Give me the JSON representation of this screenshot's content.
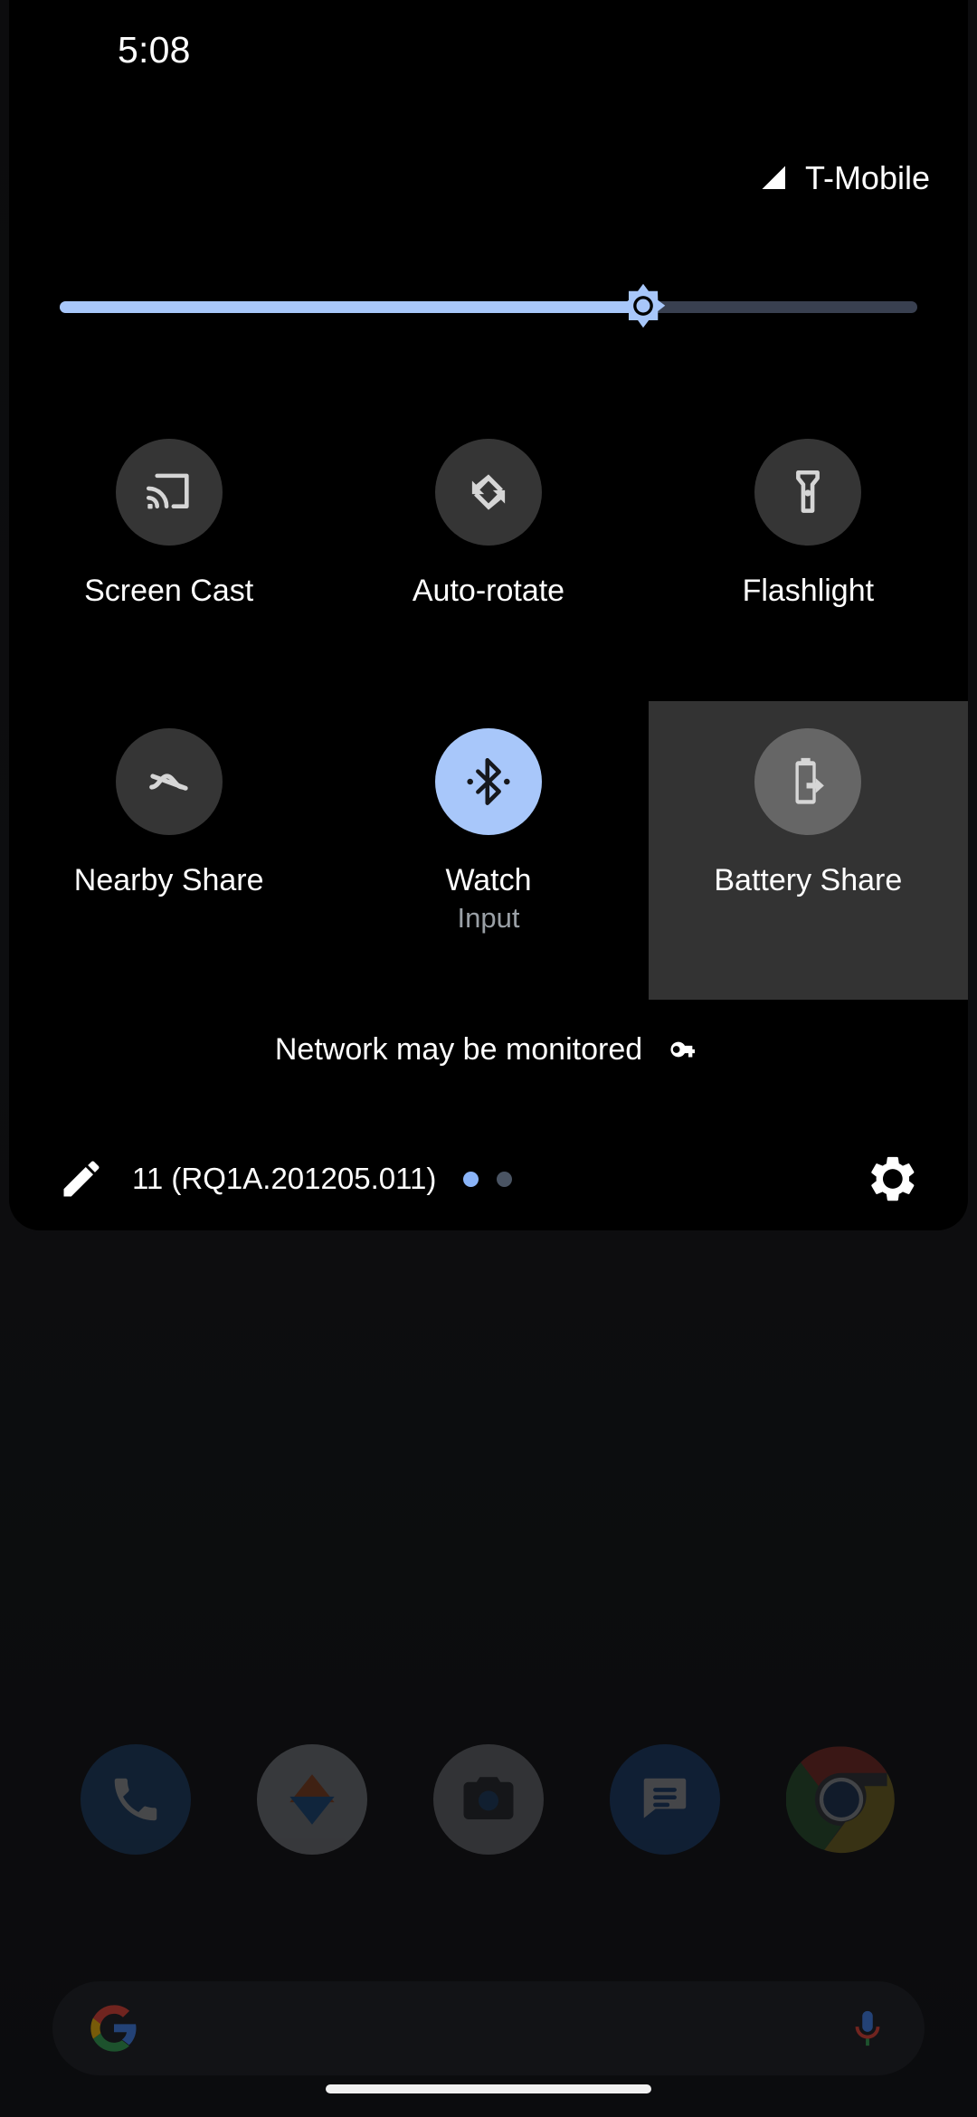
{
  "status_bar": {
    "clock": "5:08",
    "signal_icon": "signal-cellular-full-icon"
  },
  "carrier": {
    "label": "T-Mobile",
    "signal_icon": "signal-triangle-icon"
  },
  "brightness": {
    "icon": "brightness-sun-icon",
    "value_percent": 68,
    "track_on_color": "#a8c7fa",
    "track_off_color": "#394050"
  },
  "tiles": [
    {
      "label": "Screen Cast",
      "subtitle": "",
      "icon": "cast-icon",
      "state": "inactive"
    },
    {
      "label": "Auto-rotate",
      "subtitle": "",
      "icon": "auto-rotate-icon",
      "state": "inactive"
    },
    {
      "label": "Flashlight",
      "subtitle": "",
      "icon": "flashlight-icon",
      "state": "inactive"
    },
    {
      "label": "Nearby Share",
      "subtitle": "",
      "icon": "nearby-share-icon",
      "state": "inactive"
    },
    {
      "label": "Watch",
      "subtitle": "Input",
      "icon": "bluetooth-icon",
      "state": "active"
    },
    {
      "label": "Battery Share",
      "subtitle": "",
      "icon": "battery-share-icon",
      "state": "selected"
    }
  ],
  "monitor_notice": {
    "text": "Network may be monitored",
    "icon": "vpn-key-icon"
  },
  "footer": {
    "edit_icon": "edit-pencil-icon",
    "build_label": "11 (RQ1A.201205.011)",
    "settings_icon": "gear-icon",
    "page_dots": [
      {
        "active": true
      },
      {
        "active": false
      }
    ]
  },
  "home_screen": {
    "dock": [
      {
        "name": "Phone",
        "icon": "phone-icon"
      },
      {
        "name": "Photos",
        "icon": "photos-icon"
      },
      {
        "name": "Camera",
        "icon": "camera-icon"
      },
      {
        "name": "Messages",
        "icon": "messages-icon"
      },
      {
        "name": "Chrome",
        "icon": "chrome-icon"
      }
    ],
    "search_bar": {
      "logo_icon": "google-g-icon",
      "mic_icon": "microphone-icon"
    },
    "home_gesture_bar": "home-indicator"
  },
  "colors": {
    "panel_background": "#000000",
    "tile_inactive": "#353535",
    "tile_active": "#a8c7fa",
    "tile_selected_bg": "#333333",
    "accent_blue": "#8ab4f8",
    "text_primary": "#ffffff",
    "text_secondary": "#9aa0a6"
  }
}
